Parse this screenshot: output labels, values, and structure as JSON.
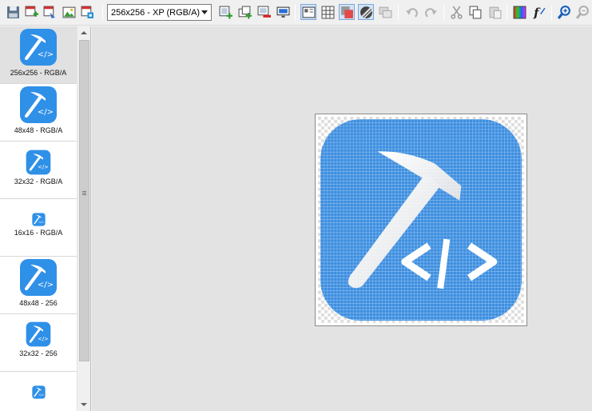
{
  "toolbar": {
    "format_value": "256x256 - XP (RGB/A)",
    "tools": [
      {
        "name": "save",
        "icon": "save-icon"
      },
      {
        "name": "new-image",
        "icon": "new-image-icon"
      },
      {
        "name": "image-properties",
        "icon": "image-properties-icon"
      },
      {
        "name": "import-image",
        "icon": "import-image-icon"
      },
      {
        "name": "export-image",
        "icon": "export-image-icon"
      },
      {
        "name": "add-format",
        "icon": "add-format-icon"
      },
      {
        "name": "duplicate-format",
        "icon": "duplicate-format-icon"
      },
      {
        "name": "delete-format",
        "icon": "delete-format-icon"
      },
      {
        "name": "test-icon",
        "icon": "monitor-icon"
      },
      {
        "name": "view-mode",
        "icon": "view-mode-icon"
      },
      {
        "name": "grid",
        "icon": "grid-icon"
      },
      {
        "name": "mask",
        "icon": "mask-icon"
      },
      {
        "name": "background",
        "icon": "background-icon"
      },
      {
        "name": "layers",
        "icon": "layers-icon"
      },
      {
        "name": "undo",
        "icon": "undo-icon"
      },
      {
        "name": "redo",
        "icon": "redo-icon"
      },
      {
        "name": "cut",
        "icon": "scissors-icon"
      },
      {
        "name": "copy",
        "icon": "copy-icon"
      },
      {
        "name": "paste",
        "icon": "paste-icon"
      },
      {
        "name": "palette",
        "icon": "palette-icon"
      },
      {
        "name": "filter",
        "icon": "function-icon"
      },
      {
        "name": "zoom-in",
        "icon": "zoom-in-icon"
      },
      {
        "name": "zoom-out",
        "icon": "zoom-out-icon"
      }
    ]
  },
  "image_list": {
    "selected_index": 0,
    "items": [
      {
        "label": "256x256 - RGB/A"
      },
      {
        "label": "48x48 - RGB/A"
      },
      {
        "label": "32x32 - RGB/A"
      },
      {
        "label": "16x16 - RGB/A"
      },
      {
        "label": "48x48 - 256"
      },
      {
        "label": "32x32 - 256"
      },
      {
        "label": ""
      }
    ]
  },
  "icon_glyph": {
    "code_text": "</>"
  },
  "colors": {
    "icon_blue": "#2f90e8",
    "icon_blue_canvas": "#3c8ee0",
    "selection_bg": "#e1e1e1",
    "canvas_bg": "#e3e3e3",
    "toolbar_bg": "#f0f0f0"
  }
}
